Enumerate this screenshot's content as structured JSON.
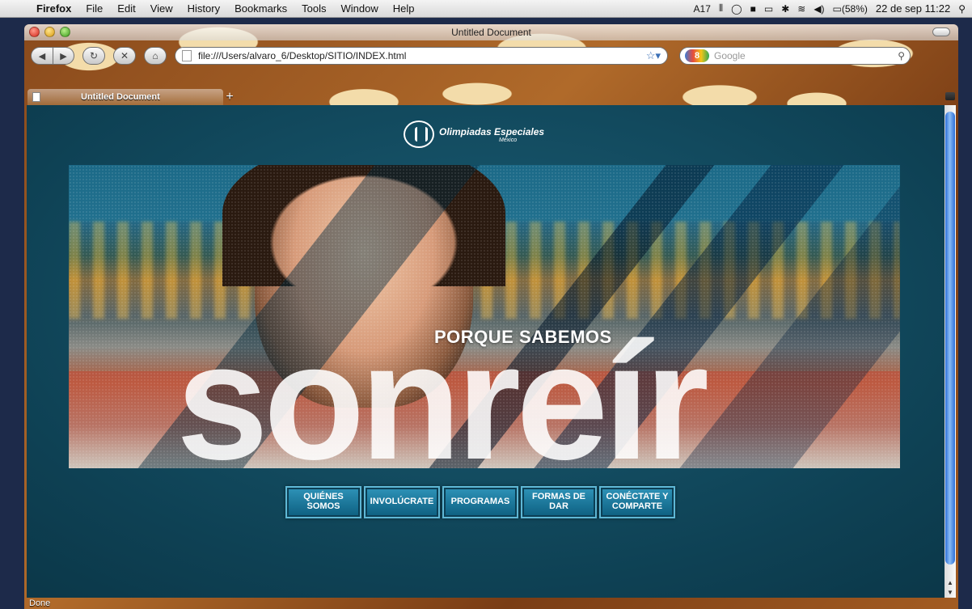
{
  "menubar": {
    "app_name": "Firefox",
    "items": [
      "File",
      "Edit",
      "View",
      "History",
      "Bookmarks",
      "Tools",
      "Window",
      "Help"
    ],
    "status": {
      "adobe_badge": "17",
      "battery": "(58%)",
      "datetime": "22 de sep 11:22"
    }
  },
  "window": {
    "title": "Untitled Document",
    "url": "file:///Users/alvaro_6/Desktop/SITIO/INDEX.html",
    "search_placeholder": "Google",
    "tab_label": "Untitled Document",
    "status_text": "Done"
  },
  "page": {
    "logo_title": "Olimpiadas Especiales",
    "logo_subtitle": "México",
    "tagline": "PORQUE SABEMOS",
    "big_word": "sonreír",
    "nav": [
      {
        "label": "QUIÉNES SOMOS"
      },
      {
        "label": "INVOLÚCRATE"
      },
      {
        "label": "PROGRAMAS"
      },
      {
        "label": "FORMAS DE DAR"
      },
      {
        "label": "CONÉCTATE Y COMPARTE"
      }
    ]
  },
  "colors": {
    "page_bg": "#0e4154",
    "button_fill": "#1c7ea3",
    "button_border": "#5fb8d6"
  }
}
